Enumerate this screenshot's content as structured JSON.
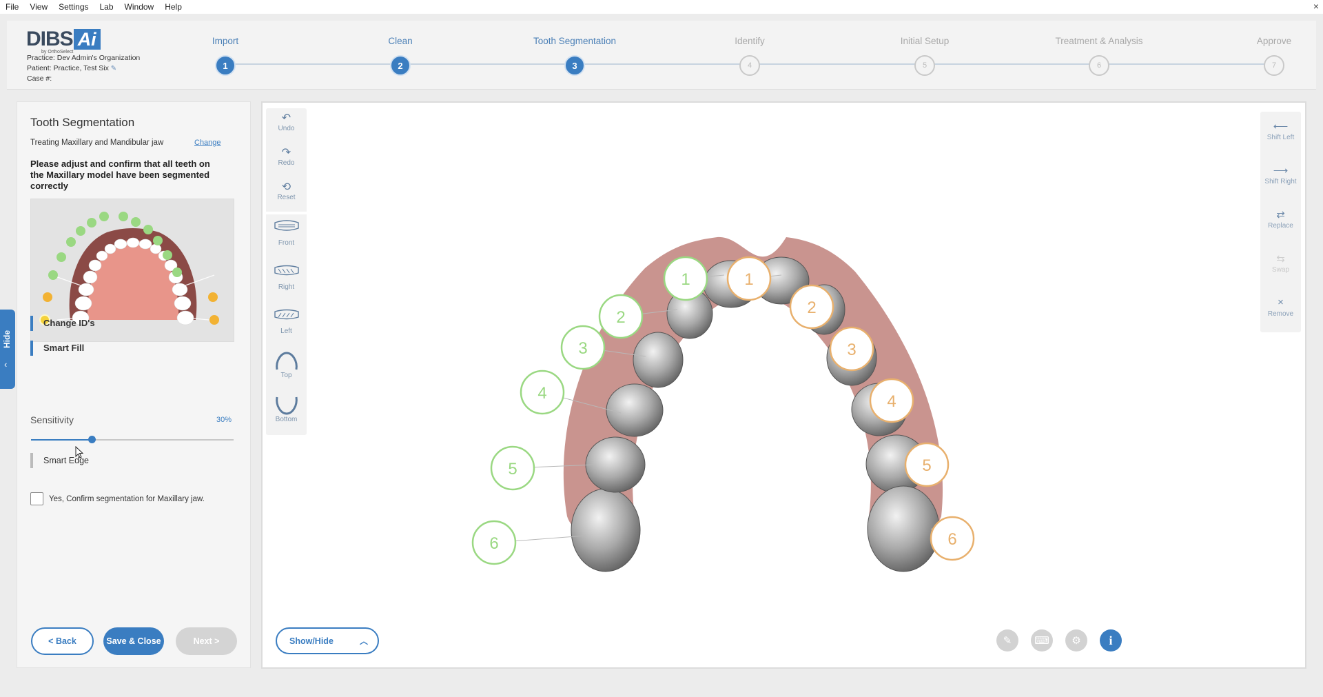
{
  "menu": [
    "File",
    "View",
    "Settings",
    "Lab",
    "Window",
    "Help"
  ],
  "close_glyph": "×",
  "logo": {
    "main": "DIBS",
    "accent": "Ai",
    "sub": "by OrthoSelect"
  },
  "practice": "Practice: Dev Admin's Organization",
  "patient": "Patient: Practice, Test Six",
  "case": "Case #:",
  "steps": [
    {
      "label": "Import",
      "num": "1"
    },
    {
      "label": "Clean",
      "num": "2"
    },
    {
      "label": "Tooth Segmentation",
      "num": "3"
    },
    {
      "label": "Identify",
      "num": "4"
    },
    {
      "label": "Initial Setup",
      "num": "5"
    },
    {
      "label": "Treatment & Analysis",
      "num": "6"
    },
    {
      "label": "Approve",
      "num": "7"
    }
  ],
  "panel": {
    "title": "Tooth Segmentation",
    "treating": "Treating Maxillary and Mandibular jaw",
    "change": "Change",
    "instructions": "Please adjust and confirm that all teeth on the Maxillary model have been segmented correctly",
    "change_ids": "Change ID's",
    "smart_fill": "Smart Fill",
    "sensitivity_label": "Sensitivity",
    "sensitivity_value": "30%",
    "sensitivity_fraction": 0.3,
    "smart_edge": "Smart Edge",
    "confirm": "Yes, Confirm segmentation for Maxillary jaw.",
    "back": "<  Back",
    "save": "Save & Close",
    "next": "Next  >"
  },
  "hide_tab": {
    "label": "Hide",
    "arrow": "‹"
  },
  "left_toolbar": [
    {
      "label": "Undo",
      "icon": "undo-icon",
      "glyph": "↶"
    },
    {
      "label": "Redo",
      "icon": "redo-icon",
      "glyph": "↷"
    },
    {
      "label": "Reset",
      "icon": "reset-icon",
      "glyph": "⟲"
    },
    {
      "label": "Front",
      "icon": "front-view-icon"
    },
    {
      "label": "Right",
      "icon": "right-view-icon"
    },
    {
      "label": "Left",
      "icon": "left-view-icon"
    },
    {
      "label": "Top",
      "icon": "top-view-icon"
    },
    {
      "label": "Bottom",
      "icon": "bottom-view-icon"
    }
  ],
  "right_toolbar": [
    {
      "label": "Shift Left",
      "icon": "shift-left-icon",
      "glyph": "⟵"
    },
    {
      "label": "Shift Right",
      "icon": "shift-right-icon",
      "glyph": "⟶"
    },
    {
      "label": "Replace",
      "icon": "replace-icon",
      "glyph": "⇄"
    },
    {
      "label": "Swap",
      "icon": "swap-icon",
      "glyph": "⇆"
    },
    {
      "label": "Remove",
      "icon": "remove-icon",
      "glyph": "×"
    }
  ],
  "show_hide": "Show/Hide",
  "tooth_labels": {
    "left": [
      "1",
      "2",
      "3",
      "4",
      "5",
      "6"
    ],
    "right": [
      "1",
      "2",
      "3",
      "4",
      "5",
      "6"
    ]
  },
  "colors": {
    "accent": "#3a7dc1",
    "green": "#8fd17a",
    "orange": "#e8b06d",
    "gum": "#c89894",
    "tooth": "#a8a8a8"
  }
}
